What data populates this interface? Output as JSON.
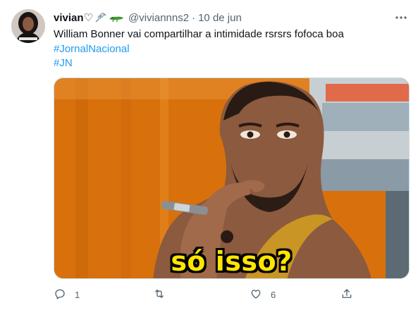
{
  "tweet": {
    "display_name": "vivian♡",
    "handle": "@viviannns2",
    "separator": "·",
    "date": "10 de jun",
    "text_lines": [
      "William Bonner vai compartilhar a intimidade rsrsrs fofoca boa"
    ],
    "hashtags": [
      "#JornalNacional",
      "#JN"
    ],
    "media": {
      "caption": "só isso?"
    },
    "actions": {
      "reply_count": "1",
      "retweet_count": "",
      "like_count": "6"
    }
  },
  "colors": {
    "accent": "#1d9bf0",
    "secondary_text": "#536471",
    "caption_yellow": "#ffe600"
  },
  "icons": [
    "syringe-icon",
    "alligator-icon",
    "more-icon",
    "reply-icon",
    "retweet-icon",
    "like-icon",
    "share-icon"
  ]
}
